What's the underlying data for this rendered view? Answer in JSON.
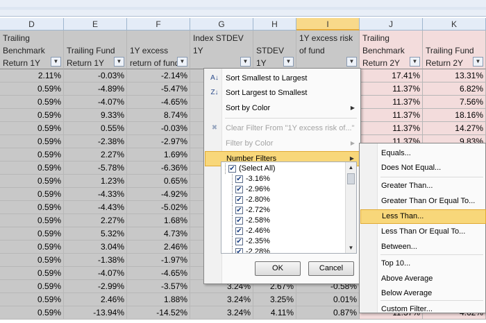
{
  "columns": [
    "D",
    "E",
    "F",
    "G",
    "H",
    "I",
    "J",
    "K"
  ],
  "headers": [
    "Trailing\nBenchmark\nReturn 1Y",
    "\nTrailing Fund\nReturn 1Y",
    "\n1Y excess\nreturn of fund",
    "Index STDEV\n1Y",
    "\nSTDEV 1Y",
    "1Y excess risk\nof fund",
    "Trailing\nBenchmark\nReturn 2Y",
    "\nTrailing Fund\nReturn 2Y"
  ],
  "rows": [
    [
      "2.11%",
      "-0.03%",
      "-2.14%",
      "",
      "",
      "",
      "17.41%",
      "13.31%"
    ],
    [
      "0.59%",
      "-4.89%",
      "-5.47%",
      "",
      "",
      "",
      "11.37%",
      "6.82%"
    ],
    [
      "0.59%",
      "-4.07%",
      "-4.65%",
      "",
      "",
      "",
      "11.37%",
      "7.56%"
    ],
    [
      "0.59%",
      "9.33%",
      "8.74%",
      "",
      "",
      "",
      "11.37%",
      "18.16%"
    ],
    [
      "0.59%",
      "0.55%",
      "-0.03%",
      "",
      "",
      "",
      "11.37%",
      "14.27%"
    ],
    [
      "0.59%",
      "-2.38%",
      "-2.97%",
      "",
      "",
      "",
      "11.37%",
      "9.83%"
    ],
    [
      "0.59%",
      "2.27%",
      "1.69%",
      "",
      "",
      "",
      "",
      ""
    ],
    [
      "0.59%",
      "-5.78%",
      "-6.36%",
      "",
      "",
      "",
      "",
      ""
    ],
    [
      "0.59%",
      "1.23%",
      "0.65%",
      "",
      "",
      "",
      "",
      ""
    ],
    [
      "0.59%",
      "-4.33%",
      "-4.92%",
      "",
      "",
      "",
      "",
      ""
    ],
    [
      "0.59%",
      "-4.43%",
      "-5.02%",
      "",
      "",
      "",
      "",
      ""
    ],
    [
      "0.59%",
      "2.27%",
      "1.68%",
      "",
      "",
      "",
      "",
      ""
    ],
    [
      "0.59%",
      "5.32%",
      "4.73%",
      "",
      "",
      "",
      "",
      ""
    ],
    [
      "0.59%",
      "3.04%",
      "2.46%",
      "",
      "",
      "",
      "",
      ""
    ],
    [
      "0.59%",
      "-1.38%",
      "-1.97%",
      "",
      "",
      "",
      "",
      ""
    ],
    [
      "0.59%",
      "-4.07%",
      "-4.65%",
      "",
      "",
      "",
      "",
      ""
    ],
    [
      "0.59%",
      "-2.99%",
      "-3.57%",
      "3.24%",
      "2.67%",
      "-0.58%",
      "",
      ""
    ],
    [
      "0.59%",
      "2.46%",
      "1.88%",
      "3.24%",
      "3.25%",
      "0.01%",
      "",
      ""
    ],
    [
      "0.59%",
      "-13.94%",
      "-14.52%",
      "3.24%",
      "4.11%",
      "0.87%",
      "11.37%",
      "4.62%"
    ]
  ],
  "filter_menu": {
    "sort_asc": "Sort Smallest to Largest",
    "sort_desc": "Sort Largest to Smallest",
    "sort_color": "Sort by Color",
    "clear_filter": "Clear Filter From \"1Y excess risk of...\"",
    "filter_color": "Filter by Color",
    "number_filters": "Number Filters",
    "list": [
      "(Select All)",
      "-3.16%",
      "-2.96%",
      "-2.80%",
      "-2.72%",
      "-2.58%",
      "-2.46%",
      "-2.35%",
      "-2.28%"
    ],
    "ok": "OK",
    "cancel": "Cancel"
  },
  "submenu": {
    "items": [
      "Equals...",
      "Does Not Equal...",
      "Greater Than...",
      "Greater Than Or Equal To...",
      "Less Than...",
      "Less Than Or Equal To...",
      "Between...",
      "Top 10...",
      "Above Average",
      "Below Average",
      "Custom Filter..."
    ],
    "highlighted": "Less Than..."
  },
  "icons": {
    "sort_asc": "sort-ascending-icon",
    "sort_desc": "sort-descending-icon",
    "clear_filter": "clear-filter-icon",
    "filter_dropdown": "filter-dropdown-icon"
  },
  "colors": {
    "gray_cells": "#c8c8c8",
    "pink_cells": "#f3dcdc",
    "highlight": "#f8d77a",
    "selected_column": "#f8d98a"
  }
}
